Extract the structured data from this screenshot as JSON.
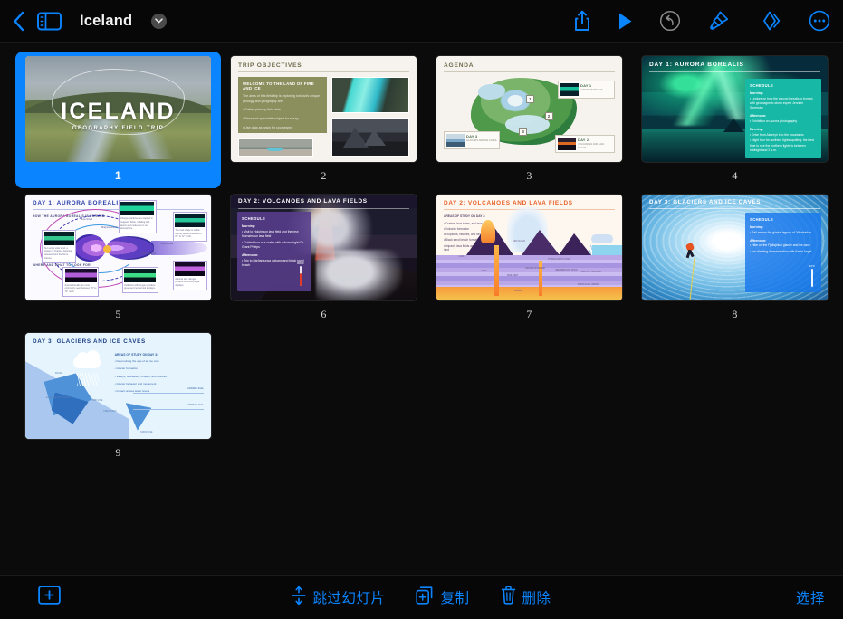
{
  "app": {
    "name": "Keynote",
    "accent_color": "#0a84ff",
    "background_color": "#0b0b0b"
  },
  "toolbar": {
    "back_label": "Back",
    "back_icon": "chevron-left-icon",
    "sidebar_icon": "sidebar-toggle-icon",
    "document_title": "Iceland",
    "title_chevron_icon": "chevron-down-icon",
    "right_actions": [
      {
        "name": "share",
        "icon": "share-icon",
        "label": "Share"
      },
      {
        "name": "play",
        "icon": "play-icon",
        "label": "Play"
      },
      {
        "name": "undo",
        "icon": "undo-icon",
        "label": "Undo"
      },
      {
        "name": "format",
        "icon": "paintbrush-icon",
        "label": "Format"
      },
      {
        "name": "animate",
        "icon": "animate-icon",
        "label": "Animate"
      },
      {
        "name": "more",
        "icon": "ellipsis-circle-icon",
        "label": "More"
      }
    ]
  },
  "bottom_bar": {
    "add_slide_icon": "add-slide-icon",
    "add_slide_label": "+",
    "actions": [
      {
        "name": "skip-slide",
        "icon": "skip-slide-icon",
        "label": "跳过幻灯片"
      },
      {
        "name": "duplicate",
        "icon": "duplicate-icon",
        "label": "复制"
      },
      {
        "name": "delete",
        "icon": "trash-icon",
        "label": "删除"
      }
    ],
    "select_label": "选择"
  },
  "slides": [
    {
      "number": "1",
      "selected": true,
      "kind": "title-photo",
      "title": "ICELAND",
      "subtitle": "GEOGRAPHY FIELD TRIP"
    },
    {
      "number": "2",
      "selected": false,
      "kind": "objectives",
      "header": "TRIP OBJECTIVES",
      "box_title": "WELCOME TO THE LAND OF FIRE AND ICE",
      "box_paragraph": "The aims of this field trip is exploring Iceland's unique geology and geography are:",
      "bullets": [
        "• Gather primary field data",
        "• Research specialist subject for essay",
        "• Use data as basis for coursework"
      ],
      "photo_caption": "Lava fields"
    },
    {
      "number": "3",
      "selected": false,
      "kind": "agenda-map",
      "header": "AGENDA",
      "pins": [
        "1",
        "2",
        "3"
      ],
      "callouts": [
        {
          "day": "DAY 1",
          "subtitle": "AURORA BOREALIS",
          "bullets": [
            "• Lecture on aurora borealis",
            "• How it's formed",
            "• Viewing of northern lights"
          ]
        },
        {
          "day": "DAY 2",
          "subtitle": "VOLCANOES AND LAVA FIELDS",
          "bullets": [
            "• Lava tubes, Holuhraun and Bárðarbunga",
            "• Guided tour of the crater",
            "• Trip to Bárðarbunga volcano and black sand beach"
          ]
        },
        {
          "day": "DAY 3",
          "subtitle": "GLACIERS AND ICE CAVES",
          "bullets": [
            "• Sail across Jökulsárlón lagoon",
            "• Hike on Fjallsjökull glacier"
          ]
        }
      ]
    },
    {
      "number": "4",
      "selected": false,
      "kind": "aurora-photo",
      "header": "DAY 1: AURORA BOREALIS",
      "panel_title": "SCHEDULE",
      "blocks": [
        {
          "heading": "Morning:",
          "lines": [
            "• Lecture on how the aurora borealis is formed, with geomagnetic storm expert Jennifer Sorensen"
          ]
        },
        {
          "heading": "Afternoon:",
          "lines": [
            "• Exhibition on aurora photography"
          ]
        },
        {
          "heading": "Evening:",
          "lines": [
            "• Drive from Akureyri into the mountains",
            "• Night tour for northern lights spotting: the best time to see the northern lights is between midnight and 2 a.m."
          ]
        }
      ]
    },
    {
      "number": "5",
      "selected": false,
      "kind": "aurora-diagram",
      "header": "DAY 1: AURORA BOREALIS",
      "section_1": "HOW THE AURORA BOREALIS IS FORMED",
      "section_2": "WHERE AND WHAT TO LOOK FOR",
      "labels": [
        "Bow shock",
        "Magnetosheath",
        "Magnetopause",
        "Solar wind",
        "Plasma sheet",
        "Radiation belts",
        "Magnetotail",
        "Auroral oval",
        "Field lines"
      ],
      "cards": [
        "Charged particles are trapped in magnetic fields, colliding with atoms and molecules in our atmosphere.",
        "The oval shape is visible directly above a latitude of 65° to 72° north.",
        "Sun emits solar wind, a stream of charged particles released from the Sun's corona.",
        "Aurora borealis are most commonly seen between 65° to 72° north.",
        "Collisions with oxygen produce green and red auroral displays.",
        "Auroras with nitrogen produce blue and purple displays."
      ]
    },
    {
      "number": "6",
      "selected": false,
      "kind": "volcano-photo",
      "header": "DAY 2: VOLCANOES AND LAVA FIELDS",
      "panel_title": "SCHEDULE",
      "blocks": [
        {
          "heading": "Morning:",
          "lines": [
            "• Visit to Holuhraun lava field and the new Nornahraun lava field",
            "• Guided tour of a crater with volcanologist Dr. Grant Phelps"
          ]
        },
        {
          "heading": "Afternoon:",
          "lines": [
            "• Trip to Bárðarbunga volcano and black sand beach"
          ]
        }
      ],
      "temperature_label": "900°F"
    },
    {
      "number": "7",
      "selected": false,
      "kind": "volcano-diagram",
      "header": "DAY 2: VOLCANOES AND LAVA FIELDS",
      "section_title": "AREAS OF STUDY ON DAY 2:",
      "bullets": [
        "• Craters, lava tubes, and lava fields",
        "• Volcanic formation",
        "• Eruptions, fissures, and structure",
        "• Black sand beach formation",
        "• Impacts lava fields and volcanoes have on the land"
      ],
      "labels": [
        "LAVA",
        "ASH CLOUD",
        "VENT",
        "SIDE VENT",
        "MAGMA CHAMBER",
        "PYROCLASTIC FLOW",
        "SEDIMENTARY ROCK",
        "ICE CAP / GLACIER",
        "SUBGLACIAL WATER",
        "MAGMA"
      ]
    },
    {
      "number": "8",
      "selected": false,
      "kind": "glacier-photo",
      "header": "DAY 3: GLACIERS AND ICE CAVES",
      "panel_title": "SCHEDULE",
      "blocks": [
        {
          "heading": "Morning:",
          "lines": [
            "• Sail across the glacial lagoon of Jökulsárlón"
          ]
        },
        {
          "heading": "Afternoon:",
          "lines": [
            "• Hike on the Fjallsjökull glacier and ice cave",
            "• Ice climbing demonstration with Kevin Angel"
          ]
        }
      ],
      "temperature_label": "32°F"
    },
    {
      "number": "9",
      "selected": false,
      "kind": "glacier-diagram",
      "header": "DAY 3: GLACIERS AND ICE CAVES",
      "section_title": "AREAS OF STUDY ON DAY 3:",
      "bullets": [
        "• Determining the age of an ice core",
        "• Glacier formation",
        "• Valleys, crevasses, cirques, and fissures",
        "• Glacier behavior and movement",
        "• Impact on sea water levels"
      ],
      "labels": [
        "SNOW",
        "ACCUMULATION ZONE",
        "FIRN LINE",
        "CREVASSES",
        "SNOW LINE",
        "SUMMER LEVEL",
        "WINTER LEVEL",
        "ABLATION ZONE"
      ]
    }
  ]
}
